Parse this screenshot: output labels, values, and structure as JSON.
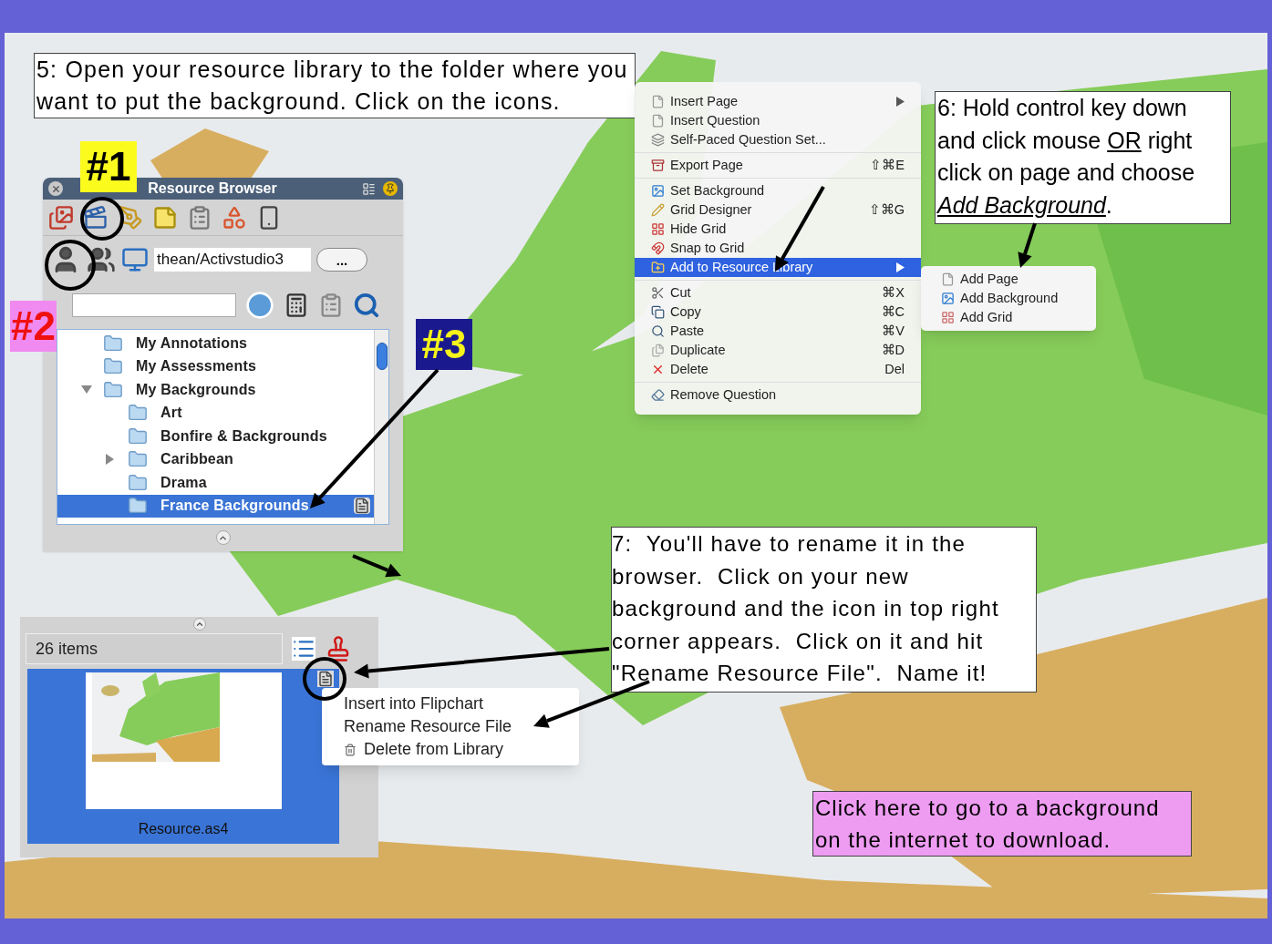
{
  "step5": {
    "text": "5: Open your resource library to the folder where you want to put the background. Click on the icons."
  },
  "markers": [
    {
      "label": "#1",
      "kind": "yellow"
    },
    {
      "label": "#2",
      "kind": "pink"
    },
    {
      "label": "#3",
      "kind": "navy"
    }
  ],
  "resource_browser": {
    "title": "Resource Browser",
    "path": "thean/Activstudio3",
    "browse_button": "...",
    "folders": [
      {
        "label": "My Annotations",
        "selected": false
      },
      {
        "label": "My Assessments",
        "selected": false
      },
      {
        "label": "My Backgrounds",
        "toggle": {
          "expanded": true
        },
        "selected": false,
        "children": [
          {
            "label": "Art",
            "selected": false
          },
          {
            "label": "Bonfire & Backgrounds",
            "selected": false
          },
          {
            "label": "Caribbean",
            "toggle": {
              "expanded": false
            },
            "selected": false
          },
          {
            "label": "Drama",
            "selected": false
          },
          {
            "label": "France Backgrounds",
            "selected": true
          }
        ]
      }
    ]
  },
  "context_menu": {
    "groups": [
      [
        {
          "label": "Insert Page",
          "submenu": true,
          "selected": false
        },
        {
          "label": "Insert Question",
          "submenu": false,
          "selected": false
        },
        {
          "label": "Self-Paced Question Set...",
          "submenu": false,
          "selected": false
        }
      ],
      [
        {
          "label": "Export Page",
          "shortcut": "⇧⌘E",
          "submenu": false,
          "selected": false
        }
      ],
      [
        {
          "label": "Set Background",
          "submenu": false,
          "selected": false
        },
        {
          "label": "Grid Designer",
          "shortcut": "⇧⌘G",
          "submenu": false,
          "selected": false
        },
        {
          "label": "Hide Grid",
          "submenu": false,
          "selected": false
        },
        {
          "label": "Snap to Grid",
          "submenu": false,
          "selected": false
        },
        {
          "label": "Add to Resource Library",
          "submenu": true,
          "selected": true
        }
      ],
      [
        {
          "label": "Cut",
          "shortcut": "⌘X",
          "submenu": false,
          "selected": false
        },
        {
          "label": "Copy",
          "shortcut": "⌘C",
          "submenu": false,
          "selected": false
        },
        {
          "label": "Paste",
          "shortcut": "⌘V",
          "submenu": false,
          "selected": false
        },
        {
          "label": "Duplicate",
          "shortcut": "⌘D",
          "submenu": false,
          "selected": false
        },
        {
          "label": "Delete",
          "shortcut": "Del",
          "submenu": false,
          "selected": false
        }
      ],
      [
        {
          "label": "Remove Question",
          "submenu": false,
          "selected": false
        }
      ]
    ],
    "submenu": [
      {
        "label": "Add Page"
      },
      {
        "label": "Add Background"
      },
      {
        "label": "Add Grid"
      }
    ]
  },
  "step6": {
    "segments": [
      {
        "text": "6: Hold control key down and click mouse ",
        "underline": false,
        "italic": false
      },
      {
        "text": "OR",
        "underline": true,
        "italic": false
      },
      {
        "text": " right click on page and choose ",
        "underline": false,
        "italic": false
      },
      {
        "text": "Add Background",
        "underline": true,
        "italic": true
      },
      {
        "text": ".",
        "underline": false,
        "italic": false
      }
    ]
  },
  "items_panel": {
    "count": "26 items",
    "tile": {
      "name": "Resource.as4",
      "selected": true
    },
    "menu": [
      {
        "label": "Insert into Flipchart",
        "kind": "plain"
      },
      {
        "label": "Rename Resource File",
        "kind": "plain"
      },
      {
        "label": "Delete from Library",
        "kind": "trash"
      }
    ]
  },
  "step7": {
    "text": "7:  You'll have to rename it in the browser.  Click on your new background and the icon in top right corner appears.  Click on it and hit \"Rename Resource File\".  Name it!"
  },
  "link_box": {
    "text": "Click here to go to a background on the internet to download."
  }
}
